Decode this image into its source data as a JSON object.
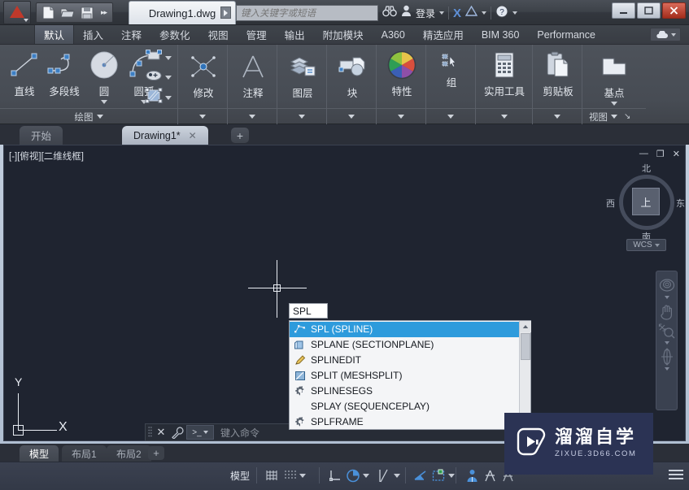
{
  "titlebar": {
    "document_name": "Drawing1.dwg",
    "search_placeholder": "键入关键字或短语",
    "sign_in": "登录",
    "qat_icons": [
      "new-file-icon",
      "open-folder-icon",
      "save-icon",
      "more-icon"
    ],
    "right_icons": [
      "binoculars-icon",
      "user-icon",
      "exchange-icon",
      "autodesk-icon",
      "help-icon"
    ],
    "window_buttons": [
      "minimize",
      "restore",
      "close"
    ]
  },
  "ribbon_tabs": [
    {
      "label": "默认",
      "active": true
    },
    {
      "label": "插入",
      "active": false
    },
    {
      "label": "注释",
      "active": false
    },
    {
      "label": "参数化",
      "active": false
    },
    {
      "label": "视图",
      "active": false
    },
    {
      "label": "管理",
      "active": false
    },
    {
      "label": "输出",
      "active": false
    },
    {
      "label": "附加模块",
      "active": false
    },
    {
      "label": "A360",
      "active": false
    },
    {
      "label": "精选应用",
      "active": false
    },
    {
      "label": "BIM 360",
      "active": false
    },
    {
      "label": "Performance",
      "active": false
    }
  ],
  "ribbon_panels": [
    {
      "title": "绘图",
      "has_dropdown": true,
      "buttons": [
        {
          "label": "直线",
          "icon": "line-icon"
        },
        {
          "label": "多段线",
          "icon": "polyline-icon"
        },
        {
          "label": "圆",
          "icon": "circle-icon",
          "dropdown": true
        },
        {
          "label": "圆弧",
          "icon": "arc-icon",
          "dropdown": true
        }
      ],
      "small_buttons": [
        {
          "icon": "rectangle-icon"
        },
        {
          "icon": "ellipse-icon"
        },
        {
          "icon": "hatch-icon"
        }
      ]
    },
    {
      "title": "修改",
      "label": "修改",
      "icon": "modify-icon",
      "has_dropdown": true
    },
    {
      "title": "注释",
      "label": "注释",
      "icon": "annotation-icon",
      "has_dropdown": true
    },
    {
      "title": "图层",
      "label": "图层",
      "icon": "layers-icon",
      "has_dropdown": true
    },
    {
      "title": "块",
      "label": "块",
      "icon": "block-icon",
      "has_dropdown": true
    },
    {
      "title": "特性",
      "label": "特性",
      "icon": "properties-icon",
      "has_dropdown": true
    },
    {
      "title": "组",
      "label": "组",
      "icon": "group-icon",
      "has_dropdown": true
    },
    {
      "title": "实用工具",
      "label": "实用工具",
      "icon": "utilities-icon",
      "has_dropdown": true
    },
    {
      "title": "剪贴板",
      "label": "剪贴板",
      "icon": "clipboard-icon",
      "has_dropdown": true
    },
    {
      "title": "视图",
      "label": "基点",
      "icon": "basepoint-icon",
      "has_dropdown": true
    }
  ],
  "file_tabs": [
    {
      "label": "开始",
      "active": false
    },
    {
      "label": "Drawing1*",
      "active": true,
      "closable": true
    }
  ],
  "file_tab_add": "+",
  "viewport": {
    "label": "[-][俯视][二维线框]",
    "ucs_x": "X",
    "ucs_y": "Y",
    "viewcube": {
      "top": "上",
      "north": "北",
      "south": "南",
      "west": "西",
      "east": "东",
      "coordinate_system": "WCS"
    },
    "nav_icons": [
      "steering-wheel-icon",
      "pan-icon",
      "zoom-extents-icon",
      "orbit-icon"
    ],
    "window_controls": [
      "minimize",
      "restore",
      "close"
    ]
  },
  "autocomplete": {
    "input_value": "SPL",
    "items": [
      {
        "label": "SPL (SPLINE)",
        "icon": "spline-icon",
        "selected": true
      },
      {
        "label": "SPLANE (SECTIONPLANE)",
        "icon": "sectionplane-icon",
        "selected": false
      },
      {
        "label": "SPLINEDIT",
        "icon": "pencil-icon",
        "selected": false
      },
      {
        "label": "SPLIT (MESHSPLIT)",
        "icon": "meshsplit-icon",
        "selected": false
      },
      {
        "label": "SPLINESEGS",
        "icon": "gear-icon",
        "selected": false
      },
      {
        "label": "SPLAY (SEQUENCEPLAY)",
        "icon": "none",
        "selected": false
      },
      {
        "label": "SPLFRAME",
        "icon": "gear-icon",
        "selected": false
      }
    ]
  },
  "command_line": {
    "placeholder": "键入命令",
    "prompt_icon": "console-icon",
    "close_icon": "close-icon",
    "settings_icon": "wrench-icon"
  },
  "layout_tabs": [
    {
      "label": "模型",
      "active": true
    },
    {
      "label": "布局1",
      "active": false
    },
    {
      "label": "布局2",
      "active": false
    }
  ],
  "layout_tab_add": "+",
  "statusbar": {
    "model_label": "模型",
    "icons": [
      "grid-display-icon",
      "snap-mode-icon",
      "ortho-icon",
      "polar-tracking-icon",
      "object-snap-icon",
      "object-snap-tracking-icon",
      "annotation-scale-icon",
      "workspace-icon",
      "customization-icon"
    ],
    "menu_icon": "hamburger-icon"
  },
  "watermark": {
    "title": "溜溜自学",
    "subtitle": "ZIXUE.3D66.COM",
    "icon": "play-logo-icon"
  },
  "colors": {
    "canvas_bg": "#1f2430",
    "accent_blue": "#2e9bdc",
    "ribbon_bg": "#474c54",
    "watermark_bg": "#2b3354",
    "crosshair": "#e9edf3"
  }
}
